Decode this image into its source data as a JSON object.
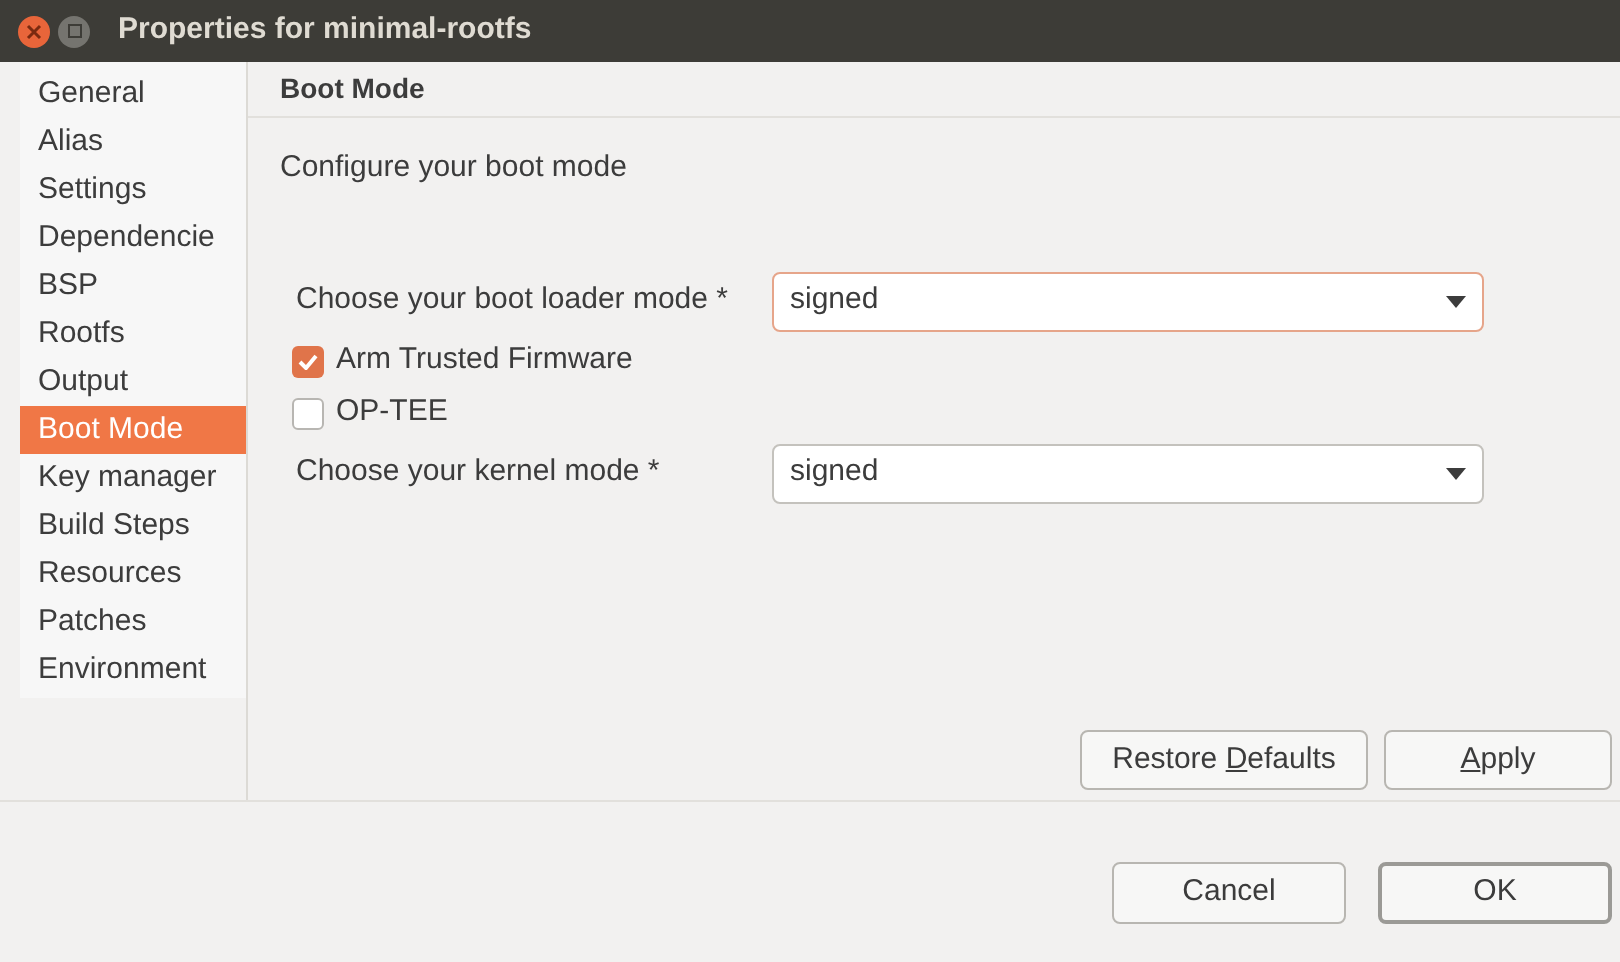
{
  "window": {
    "title": "Properties for minimal-rootfs"
  },
  "sidebar": {
    "items": [
      {
        "label": "General",
        "selected": false
      },
      {
        "label": "Alias",
        "selected": false
      },
      {
        "label": "Settings",
        "selected": false
      },
      {
        "label": "Dependencie",
        "selected": false
      },
      {
        "label": "BSP",
        "selected": false
      },
      {
        "label": "Rootfs",
        "selected": false
      },
      {
        "label": "Output",
        "selected": false
      },
      {
        "label": "Boot Mode",
        "selected": true
      },
      {
        "label": "Key manager",
        "selected": false
      },
      {
        "label": "Build Steps",
        "selected": false
      },
      {
        "label": "Resources",
        "selected": false
      },
      {
        "label": "Patches",
        "selected": false
      },
      {
        "label": "Environment",
        "selected": false
      }
    ]
  },
  "page": {
    "title": "Boot Mode",
    "description": "Configure your boot mode",
    "rows": [
      {
        "kind": "select",
        "label": "Choose your boot loader mode *",
        "value": "signed",
        "focused": true
      },
      {
        "kind": "checkbox",
        "label": "Arm Trusted Firmware",
        "checked": true
      },
      {
        "kind": "checkbox",
        "label": "OP-TEE",
        "checked": false
      },
      {
        "kind": "select",
        "label": "Choose your kernel mode *",
        "value": "signed",
        "focused": false
      }
    ],
    "buttons": [
      {
        "label_start": "Restore ",
        "mnemonic": "D",
        "label_end": "efaults"
      },
      {
        "mnemonic": "A",
        "label_end": "pply"
      }
    ]
  },
  "dialog_buttons": [
    {
      "label": "Cancel",
      "default": false
    },
    {
      "label": "OK",
      "default": true
    }
  ]
}
